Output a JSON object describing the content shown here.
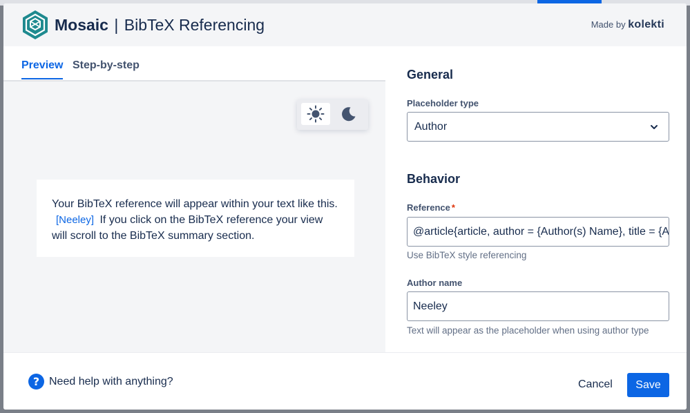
{
  "header": {
    "brand": "Mosaic",
    "separator": "|",
    "product": "BibTeX Referencing",
    "made_by_prefix": "Made by",
    "made_by_brand": "kolekti",
    "logo_icon": "mosaic-hexagon-logo"
  },
  "tabs": [
    {
      "label": "Preview",
      "active": true
    },
    {
      "label": "Step-by-step",
      "active": false
    }
  ],
  "theme_toggle": {
    "light_icon": "sun-icon",
    "dark_icon": "moon-icon",
    "selected": "light"
  },
  "preview": {
    "text_before": "Your BibTeX reference will appear within your text like this.",
    "citation": "[Neeley]",
    "text_after": "If you click on the BibTeX reference your view will scroll to the BibTeX summary section."
  },
  "settings": {
    "general_heading": "General",
    "placeholder_type_label": "Placeholder type",
    "placeholder_type_value": "Author",
    "behavior_heading": "Behavior",
    "reference_label": "Reference",
    "reference_required_mark": "*",
    "reference_value": "@article{article, author = {Author(s) Name}, title = {A",
    "reference_helper": "Use BibTeX style referencing",
    "author_name_label": "Author name",
    "author_name_value": "Neeley",
    "author_name_helper": "Text will appear as the placeholder when using author type"
  },
  "footer": {
    "help_icon_glyph": "?",
    "help_text": "Need help with anything?",
    "cancel_label": "Cancel",
    "save_label": "Save"
  },
  "colors": {
    "accent": "#0c66e4",
    "logo_teal": "#1f8a8f",
    "text": "#172b4d",
    "required": "#de350b"
  }
}
